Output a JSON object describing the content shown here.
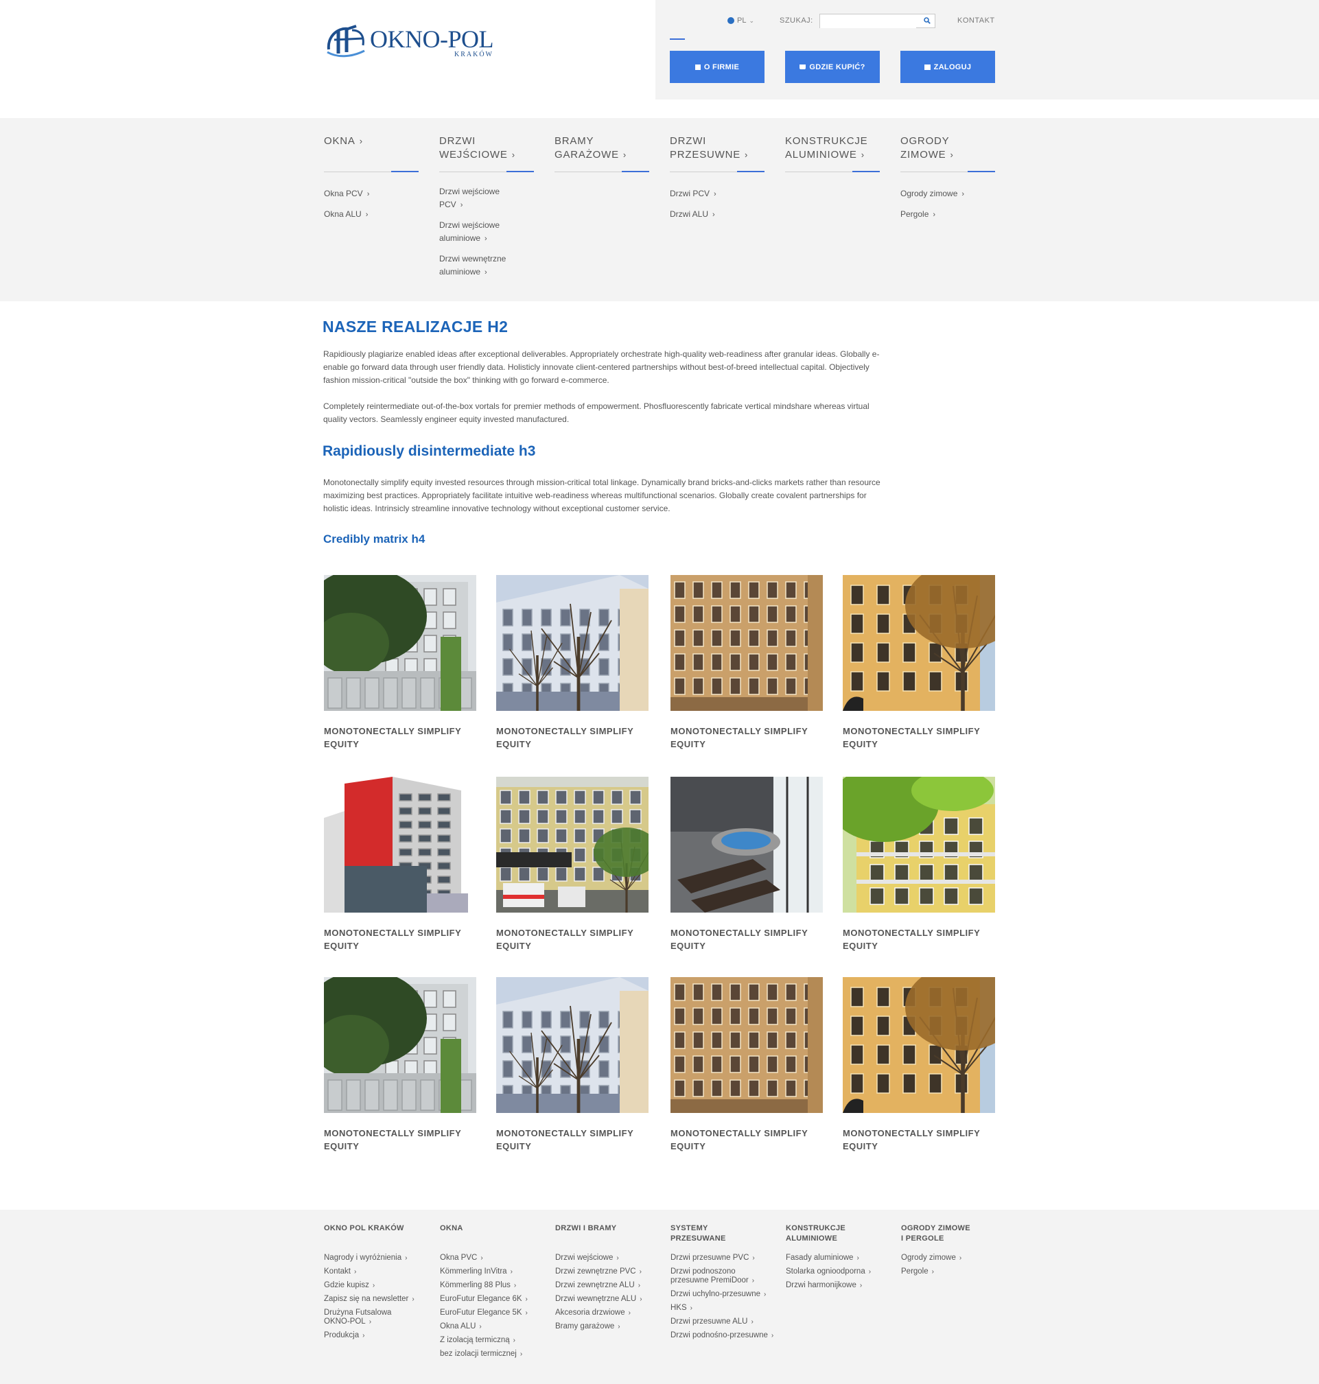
{
  "header": {
    "logo_name": "OKNO-POL",
    "logo_city": "KRAKÓW",
    "lang": "PL",
    "search_label": "SZUKAJ:",
    "search_value": "",
    "search_placeholder": "",
    "kontakt": "KONTAKT",
    "buttons": [
      {
        "label": "O FIRMIE",
        "icon": "bookmark-icon"
      },
      {
        "label": "GDZIE KUPIĆ?",
        "icon": "cart-icon"
      },
      {
        "label": "ZALOGUJ",
        "icon": "table-icon"
      }
    ],
    "accent_color": "#3b79e0"
  },
  "menu": [
    {
      "title": [
        "OKNA"
      ],
      "items": [
        [
          "Okna PCV"
        ],
        [
          "Okna ALU"
        ]
      ]
    },
    {
      "title": [
        "DRZWI",
        "WEJŚCIOWE"
      ],
      "items": [
        [
          "Drzwi wejściowe",
          "PCV"
        ],
        [
          "Drzwi wejściowe",
          "aluminiowe"
        ],
        [
          "Drzwi wewnętrzne",
          "aluminiowe"
        ]
      ]
    },
    {
      "title": [
        "BRAMY",
        "GARAŻOWE"
      ],
      "items": []
    },
    {
      "title": [
        "DRZWI",
        "PRZESUWNE"
      ],
      "items": [
        [
          "Drzwi PCV"
        ],
        [
          "Drzwi ALU"
        ]
      ]
    },
    {
      "title": [
        "KONSTRUKCJE",
        "ALUMINIOWE"
      ],
      "items": []
    },
    {
      "title": [
        "OGRODY",
        "ZIMOWE"
      ],
      "items": [
        [
          "Ogrody zimowe"
        ],
        [
          "Pergole"
        ]
      ]
    }
  ],
  "content": {
    "h2": "NASZE REALIZACJE H2",
    "p1": "Rapidiously plagiarize enabled ideas after exceptional deliverables. Appropriately orchestrate high-quality web-readiness after granular ideas. Globally e-enable go forward data through user friendly data. Holisticly innovate client-centered partnerships without best-of-breed intellectual capital. Objectively fashion mission-critical \"outside the box\" thinking with go forward e-commerce.",
    "p2": "Completely reintermediate out-of-the-box vortals for premier methods of empowerment. Phosfluorescently fabricate vertical mindshare whereas virtual quality vectors. Seamlessly engineer equity invested manufactured.",
    "h3": "Rapidiously disintermediate h3",
    "p3": "Monotonectally simplify equity invested resources through mission-critical total linkage. Dynamically brand bricks-and-clicks markets rather than resource maximizing best practices. Appropriately facilitate intuitive web-readiness whereas multifunctional scenarios. Globally create covalent partnerships for holistic ideas. Intrinsicly streamline innovative technology without exceptional customer service.",
    "h4": "Credibly matrix h4"
  },
  "gallery": [
    {
      "title": "MONOTONECTALLY SIMPLIFY EQUITY",
      "image": "green-building-trees"
    },
    {
      "title": "MONOTONECTALLY SIMPLIFY EQUITY",
      "image": "white-building-bare-tree"
    },
    {
      "title": "MONOTONECTALLY SIMPLIFY EQUITY",
      "image": "ochre-tenement"
    },
    {
      "title": "MONOTONECTALLY SIMPLIFY EQUITY",
      "image": "yellow-tenement-tree"
    },
    {
      "title": "MONOTONECTALLY SIMPLIFY EQUITY",
      "image": "red-modern-hotel"
    },
    {
      "title": "MONOTONECTALLY SIMPLIFY EQUITY",
      "image": "hospital-ambulance"
    },
    {
      "title": "MONOTONECTALLY SIMPLIFY EQUITY",
      "image": "winter-garden-jacuzzi"
    },
    {
      "title": "MONOTONECTALLY SIMPLIFY EQUITY",
      "image": "yellow-house-balconies"
    },
    {
      "title": "MONOTONECTALLY SIMPLIFY EQUITY",
      "image": "green-building-trees"
    },
    {
      "title": "MONOTONECTALLY SIMPLIFY EQUITY",
      "image": "white-building-bare-tree"
    },
    {
      "title": "MONOTONECTALLY SIMPLIFY EQUITY",
      "image": "ochre-tenement"
    },
    {
      "title": "MONOTONECTALLY SIMPLIFY EQUITY",
      "image": "yellow-tenement-tree"
    }
  ],
  "footer": [
    {
      "title": [
        "OKNO POL KRAKÓW"
      ],
      "items": [
        [
          "Nagrody i wyróżnienia"
        ],
        [
          "Kontakt"
        ],
        [
          "Gdzie kupisz"
        ],
        [
          "Zapisz się na newsletter"
        ],
        [
          "Drużyna Futsalowa",
          "OKNO-POL"
        ],
        [
          "Produkcja"
        ]
      ]
    },
    {
      "title": [
        "OKNA"
      ],
      "items": [
        [
          "Okna PVC"
        ],
        [
          "Kömmerling InVitra"
        ],
        [
          "Kömmerling 88 Plus"
        ],
        [
          "EuroFutur Elegance 6K"
        ],
        [
          "EuroFutur Elegance 5K"
        ],
        [
          "Okna ALU"
        ],
        [
          "Z izolacją termiczną"
        ],
        [
          "bez izolacji termicznej"
        ]
      ]
    },
    {
      "title": [
        "DRZWI I BRAMY"
      ],
      "items": [
        [
          "Drzwi wejściowe"
        ],
        [
          "Drzwi zewnętrzne PVC"
        ],
        [
          "Drzwi zewnętrzne ALU"
        ],
        [
          "Drzwi wewnętrzne ALU"
        ],
        [
          "Akcesoria drzwiowe"
        ],
        [
          "Bramy garażowe"
        ]
      ]
    },
    {
      "title": [
        "SYSTEMY",
        "PRZESUWANE"
      ],
      "items": [
        [
          "Drzwi przesuwne PVC"
        ],
        [
          "Drzwi podnoszono",
          "przesuwne PremiDoor"
        ],
        [
          "Drzwi uchylno-przesuwne"
        ],
        [
          "HKS"
        ],
        [
          "Drzwi przesuwne ALU"
        ],
        [
          "Drzwi podnośno-przesuwne"
        ]
      ]
    },
    {
      "title": [
        "KONSTRUKCJE",
        "ALUMINIOWE"
      ],
      "items": [
        [
          "Fasady aluminiowe"
        ],
        [
          "Stolarka ognioodporna"
        ],
        [
          "Drzwi harmonijkowe"
        ]
      ]
    },
    {
      "title": [
        "OGRODY ZIMOWE",
        "I PERGOLE"
      ],
      "items": [
        [
          "Ogrody zimowe"
        ],
        [
          "Pergole"
        ]
      ]
    }
  ]
}
